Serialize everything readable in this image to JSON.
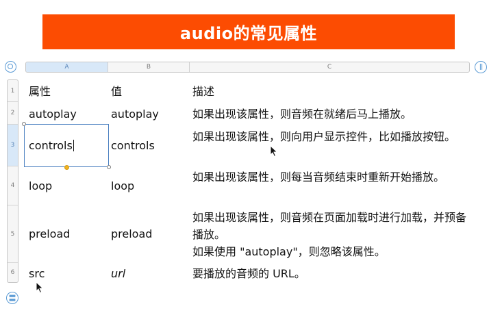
{
  "title": "audio的常见属性",
  "columns": [
    "A",
    "B",
    "C"
  ],
  "rows": [
    {
      "num": "1",
      "attr": "属性",
      "value": "值",
      "desc": "描述"
    },
    {
      "num": "2",
      "attr": "autoplay",
      "value": "autoplay",
      "desc": "如果出现该属性，则音频在就绪后马上播放。"
    },
    {
      "num": "3",
      "attr": "controls",
      "value": "controls",
      "desc": "如果出现该属性，则向用户显示控件，比如播放按钮。"
    },
    {
      "num": "4",
      "attr": "loop",
      "value": "loop",
      "desc": "如果出现该属性，则每当音频结束时重新开始播放。"
    },
    {
      "num": "5",
      "attr": "preload",
      "value": "preload",
      "desc": "如果出现该属性，则音频在页面加载时进行加载，并预备播放。",
      "desc2": "如果使用 \"autoplay\"，则忽略该属性。"
    },
    {
      "num": "6",
      "attr": "src",
      "value": "url",
      "desc": "要播放的音频的 URL。"
    }
  ],
  "selection": {
    "column": "A",
    "row": "3"
  },
  "colors": {
    "banner": "#fc4c02",
    "selection": "#4a7fc0",
    "handle": "#5b9bd5",
    "fill_handle": "#f0b323"
  },
  "icons": {
    "corner": "table-select-handle-icon",
    "columns": "column-handle-icon",
    "rows": "add-row-handle-icon"
  }
}
